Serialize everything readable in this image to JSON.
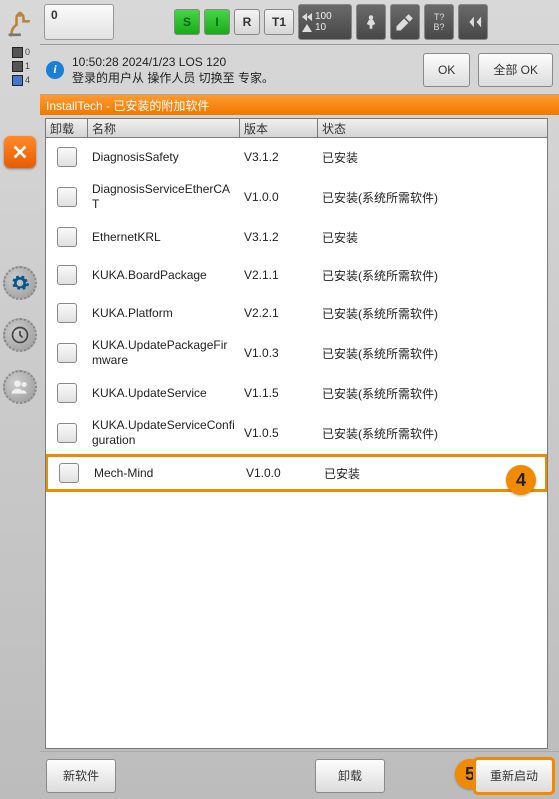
{
  "top": {
    "num": "0",
    "s": "S",
    "i": "I",
    "r": "R",
    "t1": "T1",
    "spd_top": "100",
    "spd_bot": "10",
    "tb_top": "T?",
    "tb_bot": "B?"
  },
  "msg": {
    "time": "10:50:28 2024/1/23 LOS 120",
    "text": "登录的用户从 操作人员 切换至 专家。",
    "ok": "OK",
    "all_ok": "全部 OK"
  },
  "title": "InstallTech - 已安装的附加软件",
  "headers": {
    "c0": "卸载",
    "c1": "名称",
    "c2": "版本",
    "c3": "状态"
  },
  "rows": [
    {
      "name": "DiagnosisSafety",
      "ver": "V3.1.2",
      "state": "已安装"
    },
    {
      "name": "DiagnosisServiceEtherCAT",
      "ver": "V1.0.0",
      "state": "已安装(系统所需软件)"
    },
    {
      "name": "EthernetKRL",
      "ver": "V3.1.2",
      "state": "已安装"
    },
    {
      "name": "KUKA.BoardPackage",
      "ver": "V2.1.1",
      "state": "已安装(系统所需软件)"
    },
    {
      "name": "KUKA.Platform",
      "ver": "V2.2.1",
      "state": "已安装(系统所需软件)"
    },
    {
      "name": "KUKA.UpdatePackageFirmware",
      "ver": "V1.0.3",
      "state": "已安装(系统所需软件)"
    },
    {
      "name": "KUKA.UpdateService",
      "ver": "V1.1.5",
      "state": "已安装(系统所需软件)"
    },
    {
      "name": "KUKA.UpdateServiceConfiguration",
      "ver": "V1.0.5",
      "state": "已安装(系统所需软件)"
    },
    {
      "name": "Mech-Mind",
      "ver": "V1.0.0",
      "state": "已安装"
    }
  ],
  "left": {
    "v0": "0",
    "v1": "1",
    "v2": "4"
  },
  "footer": {
    "new": "新软件",
    "uninstall": "卸载",
    "restart": "重新启动"
  },
  "callout": {
    "row": "4",
    "restart": "5"
  }
}
